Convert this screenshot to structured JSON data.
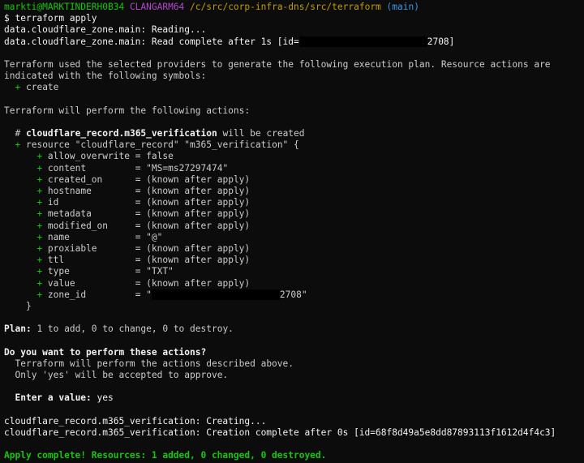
{
  "prompt": {
    "user_host": "markti@MARKTINDERH0B34",
    "shell": "CLANGARM64",
    "path": "/c/src/corp-infra-dns/src/terraform",
    "branch": "(main)",
    "symbol": "$",
    "command": "terraform apply"
  },
  "refresh": {
    "reading": "data.cloudflare_zone.main: Reading...",
    "complete_prefix": "data.cloudflare_zone.main: Read complete after 1s [id=",
    "complete_suffix": "2708]"
  },
  "intro": {
    "line1": "Terraform used the selected providers to generate the following execution plan. Resource actions are",
    "line2": "indicated with the following symbols:",
    "symbol": "+",
    "symbol_label": "create"
  },
  "actions_header": "Terraform will perform the following actions:",
  "resource": {
    "comment_hash": "#",
    "comment_name": "cloudflare_record.m365_verification",
    "comment_suffix": "will be created",
    "plus": "+",
    "decl": "resource \"cloudflare_record\" \"m365_verification\" {",
    "attributes": [
      {
        "key": "allow_overwrite",
        "value": "false"
      },
      {
        "key": "content",
        "value": "\"MS=ms27297474\""
      },
      {
        "key": "created_on",
        "value": "(known after apply)"
      },
      {
        "key": "hostname",
        "value": "(known after apply)"
      },
      {
        "key": "id",
        "value": "(known after apply)"
      },
      {
        "key": "metadata",
        "value": "(known after apply)"
      },
      {
        "key": "modified_on",
        "value": "(known after apply)"
      },
      {
        "key": "name",
        "value": "\"@\""
      },
      {
        "key": "proxiable",
        "value": "(known after apply)"
      },
      {
        "key": "ttl",
        "value": "(known after apply)"
      },
      {
        "key": "type",
        "value": "\"TXT\""
      },
      {
        "key": "value",
        "value": "(known after apply)"
      }
    ],
    "zone_key": "zone_id",
    "zone_prefix": "\"",
    "zone_suffix": "2708\"",
    "close": "}"
  },
  "plan": {
    "label": "Plan:",
    "text": "1 to add, 0 to change, 0 to destroy."
  },
  "confirm": {
    "question": "Do you want to perform these actions?",
    "line1": "Terraform will perform the actions described above.",
    "line2": "Only 'yes' will be accepted to approve.",
    "enter_label": "Enter a value:",
    "enter_value": "yes"
  },
  "apply": {
    "creating": "cloudflare_record.m365_verification: Creating...",
    "complete": "cloudflare_record.m365_verification: Creation complete after 0s [id=68f8d49a5e8dd87893113f1612d4f4c3]",
    "summary": "Apply complete! Resources: 1 added, 0 changed, 0 destroyed."
  }
}
